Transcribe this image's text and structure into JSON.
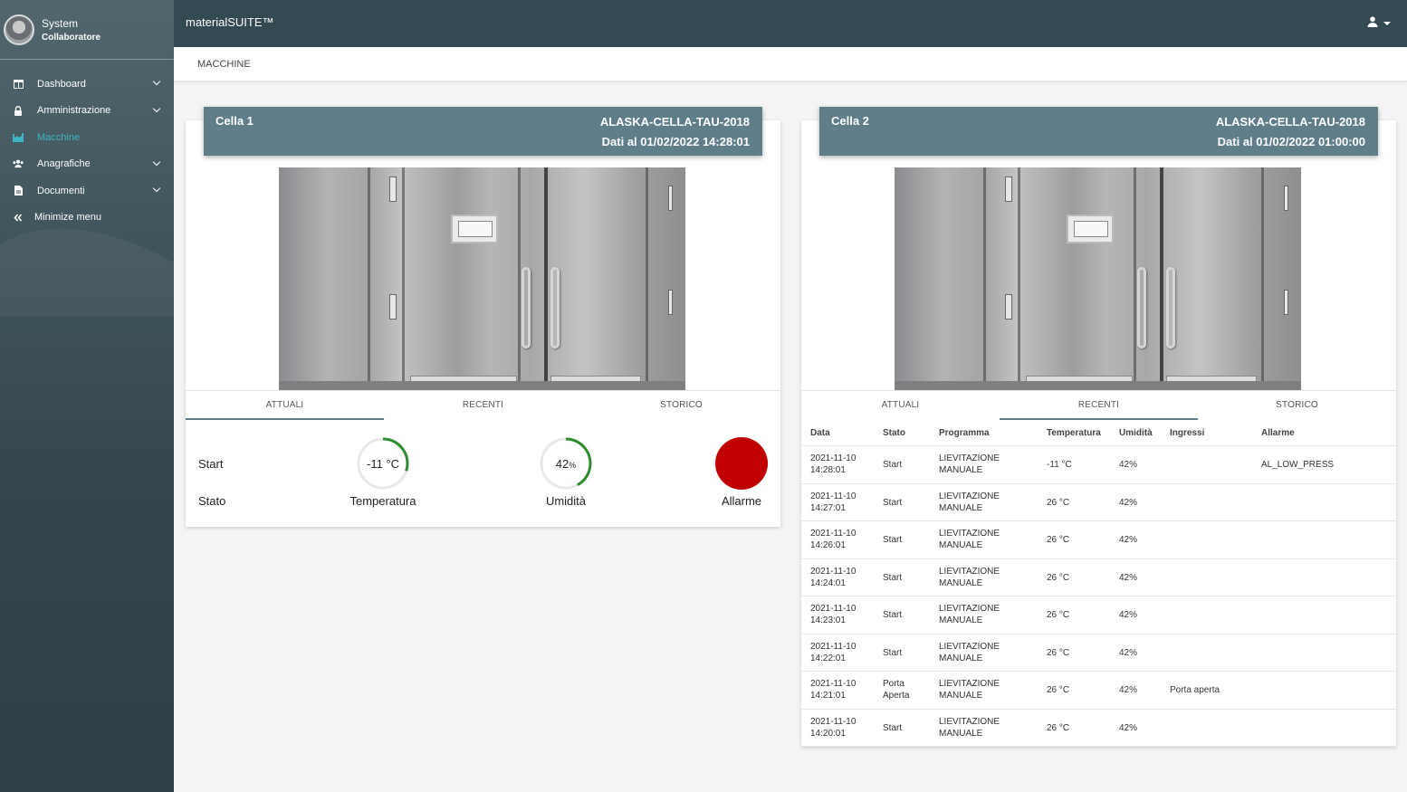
{
  "sidebar": {
    "user_name": "System",
    "user_role": "Collaboratore",
    "items": [
      {
        "label": "Dashboard"
      },
      {
        "label": "Amministrazione"
      },
      {
        "label": "Macchine"
      },
      {
        "label": "Anagrafiche"
      },
      {
        "label": "Documenti"
      },
      {
        "label": "Minimize menu"
      }
    ]
  },
  "topbar": {
    "brand": "materialSUITE™"
  },
  "breadcrumb": "MACCHINE",
  "tabs": [
    "ATTUALI",
    "RECENTI",
    "STORICO"
  ],
  "colors": {
    "sidebar": "#344a52",
    "topbar": "#344a52",
    "card_header": "#5f7e8a",
    "active_menu": "#3fb4c2",
    "gauge_green": "#2e8b2e",
    "alarm_red": "#c00000"
  },
  "cells": [
    {
      "title": "Cella 1",
      "machine": "ALASKA-CELLA-TAU-2018",
      "date": "Dati al 01/02/2022  14:28:01",
      "active_tab": "ATTUALI",
      "actual": {
        "start_label": "Start",
        "stato_label": "Stato",
        "temperature": "-11 °C",
        "temperature_caption": "Temperatura",
        "temperature_fraction": 0.3,
        "humidity_value": "42",
        "humidity_unit": "%",
        "humidity_caption": "Umidità",
        "humidity_fraction": 0.42,
        "alarm_caption": "Allarme"
      }
    },
    {
      "title": "Cella 2",
      "machine": "ALASKA-CELLA-TAU-2018",
      "date": "Dati al 01/02/2022  01:00:00",
      "active_tab": "RECENTI",
      "table": {
        "headers": [
          "Data",
          "Stato",
          "Programma",
          "Temperatura",
          "Umidità",
          "Ingressi",
          "Allarme"
        ],
        "rows": [
          {
            "date": "2021-11-10",
            "time": "14:28:01",
            "stato1": "Start",
            "stato2": "",
            "prog1": "LIEVITAZIONE",
            "prog2": "MANUALE",
            "temp": "-11 °C",
            "umid": "42%",
            "ingr": "",
            "allar": "AL_LOW_PRESS"
          },
          {
            "date": "2021-11-10",
            "time": "14:27:01",
            "stato1": "Start",
            "stato2": "",
            "prog1": "LIEVITAZIONE",
            "prog2": "MANUALE",
            "temp": "26 °C",
            "umid": "42%",
            "ingr": "",
            "allar": ""
          },
          {
            "date": "2021-11-10",
            "time": "14:26:01",
            "stato1": "Start",
            "stato2": "",
            "prog1": "LIEVITAZIONE",
            "prog2": "MANUALE",
            "temp": "26 °C",
            "umid": "42%",
            "ingr": "",
            "allar": ""
          },
          {
            "date": "2021-11-10",
            "time": "14:24:01",
            "stato1": "Start",
            "stato2": "",
            "prog1": "LIEVITAZIONE",
            "prog2": "MANUALE",
            "temp": "26 °C",
            "umid": "42%",
            "ingr": "",
            "allar": ""
          },
          {
            "date": "2021-11-10",
            "time": "14:23:01",
            "stato1": "Start",
            "stato2": "",
            "prog1": "LIEVITAZIONE",
            "prog2": "MANUALE",
            "temp": "26 °C",
            "umid": "42%",
            "ingr": "",
            "allar": ""
          },
          {
            "date": "2021-11-10",
            "time": "14:22:01",
            "stato1": "Start",
            "stato2": "",
            "prog1": "LIEVITAZIONE",
            "prog2": "MANUALE",
            "temp": "26 °C",
            "umid": "42%",
            "ingr": "",
            "allar": ""
          },
          {
            "date": "2021-11-10",
            "time": "14:21:01",
            "stato1": "Porta",
            "stato2": "Aperta",
            "prog1": "LIEVITAZIONE",
            "prog2": "MANUALE",
            "temp": "26 °C",
            "umid": "42%",
            "ingr": "Porta aperta",
            "allar": ""
          },
          {
            "date": "2021-11-10",
            "time": "14:20:01",
            "stato1": "Start",
            "stato2": "",
            "prog1": "LIEVITAZIONE",
            "prog2": "MANUALE",
            "temp": "26 °C",
            "umid": "42%",
            "ingr": "",
            "allar": ""
          }
        ]
      }
    }
  ]
}
